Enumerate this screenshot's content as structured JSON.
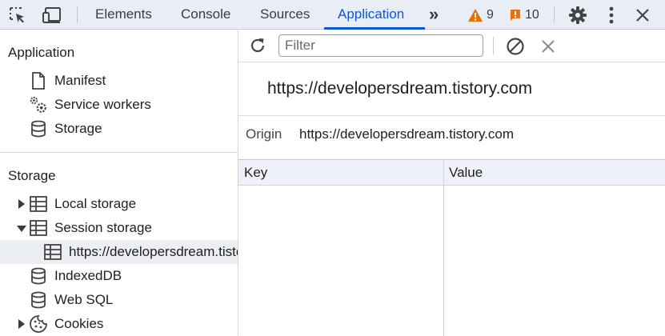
{
  "tabs": [
    {
      "label": "Elements",
      "active": false
    },
    {
      "label": "Console",
      "active": false
    },
    {
      "label": "Sources",
      "active": false
    },
    {
      "label": "Application",
      "active": true
    }
  ],
  "overflow": "»",
  "badges": {
    "warnings": "9",
    "issues": "10",
    "warning_color": "#e37400",
    "issue_color": "#e8710a"
  },
  "left": {
    "application_section": {
      "title": "Application",
      "items": [
        {
          "label": "Manifest",
          "icon": "document-icon"
        },
        {
          "label": "Service workers",
          "icon": "gears-icon"
        },
        {
          "label": "Storage",
          "icon": "database-icon"
        }
      ]
    },
    "storage_section": {
      "title": "Storage",
      "items": [
        {
          "label": "Local storage",
          "icon": "table-icon",
          "expanded": false
        },
        {
          "label": "Session storage",
          "icon": "table-icon",
          "expanded": true
        },
        {
          "label": "https://developersdream.tistory.com",
          "icon": "table-icon",
          "selected": true
        },
        {
          "label": "IndexedDB",
          "icon": "database-icon"
        },
        {
          "label": "Web SQL",
          "icon": "database-icon"
        },
        {
          "label": "Cookies",
          "icon": "cookie-icon",
          "expanded": false
        }
      ]
    }
  },
  "right": {
    "filter_placeholder": "Filter",
    "origin_heading": "https://developersdream.tistory.com",
    "origin_label": "Origin",
    "origin_value": "https://developersdream.tistory.com",
    "columns": [
      "Key",
      "Value"
    ]
  },
  "colors": {
    "accent": "#0b57d0",
    "topbar_bg": "#e9eef6",
    "selected_bg": "#ebeef3"
  }
}
